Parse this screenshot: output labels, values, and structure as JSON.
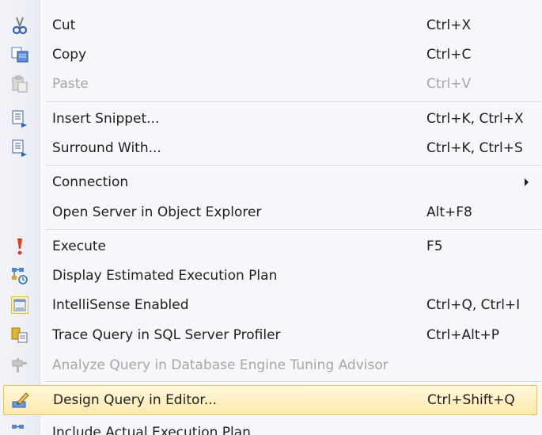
{
  "menu": {
    "items": [
      {
        "label": "Cut",
        "shortcut": "Ctrl+X",
        "icon": "scissors-icon"
      },
      {
        "label": "Copy",
        "shortcut": "Ctrl+C",
        "icon": "copy-icon"
      },
      {
        "label": "Paste",
        "shortcut": "Ctrl+V",
        "icon": "paste-icon",
        "disabled": true
      },
      {
        "label": "Insert Snippet...",
        "shortcut": "Ctrl+K, Ctrl+X",
        "icon": "insert-snippet-icon"
      },
      {
        "label": "Surround With...",
        "shortcut": "Ctrl+K, Ctrl+S",
        "icon": "surround-with-icon"
      },
      {
        "label": "Connection",
        "shortcut": "",
        "submenu": true
      },
      {
        "label": "Open Server in Object Explorer",
        "shortcut": "Alt+F8"
      },
      {
        "label": "Execute",
        "shortcut": "F5",
        "icon": "execute-icon"
      },
      {
        "label": "Display Estimated Execution Plan",
        "shortcut": "",
        "icon": "estimated-plan-icon"
      },
      {
        "label": "IntelliSense Enabled",
        "shortcut": "Ctrl+Q, Ctrl+I",
        "icon": "intellisense-icon",
        "checked": true
      },
      {
        "label": "Trace Query in SQL Server Profiler",
        "shortcut": "Ctrl+Alt+P",
        "icon": "profiler-icon"
      },
      {
        "label": "Analyze Query in Database Engine Tuning Advisor",
        "shortcut": "",
        "icon": "tuning-advisor-icon",
        "disabled": true
      },
      {
        "label": "Design Query in Editor...",
        "shortcut": "Ctrl+Shift+Q",
        "icon": "design-query-icon",
        "highlighted": true
      },
      {
        "label": "Include Actual Execution Plan",
        "shortcut": "",
        "icon": "actual-plan-icon"
      }
    ]
  },
  "colors": {
    "text": "#1e1e1e",
    "disabled_text": "#a6a6a6",
    "highlight_top": "#fff8dc",
    "highlight_bottom": "#fde9ad",
    "highlight_border": "#e5c365"
  }
}
